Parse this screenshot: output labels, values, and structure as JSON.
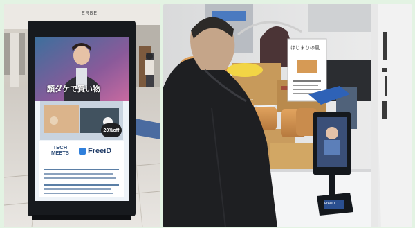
{
  "left_photo": {
    "mall_sign": "ERBE",
    "signage": {
      "headline": "顔ダケで買い物",
      "discount_badge": "20%off",
      "brand_tech_meets_line1": "TECH",
      "brand_tech_meets_line2": "MEETS",
      "brand_freeid": "FreeiD"
    }
  },
  "right_photo": {
    "shop_sign": "はじまりの風",
    "tablet_label": "FreeiD"
  },
  "colors": {
    "frame_green": "#e3f3e3",
    "signage_frame": "#171a1e",
    "freeid_blue": "#2f7fdb",
    "kiosk_stand": "#14181d"
  }
}
